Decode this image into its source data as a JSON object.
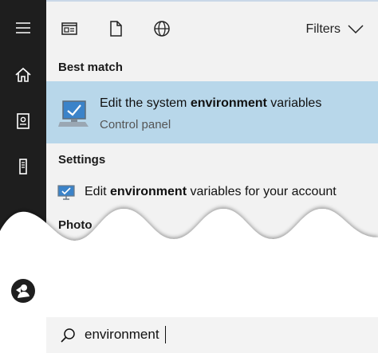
{
  "toolbar": {
    "apps_icon": "app-window-icon",
    "documents_icon": "document-icon",
    "web_icon": "globe-icon",
    "filters_label": "Filters"
  },
  "sidebar": {
    "items": [
      {
        "icon": "hamburger-menu-icon"
      },
      {
        "icon": "home-icon"
      },
      {
        "icon": "notebook-icon"
      },
      {
        "icon": "tower-icon"
      }
    ],
    "bottom_icon": "user-icon"
  },
  "results": {
    "best_match_header": "Best match",
    "best_match": {
      "title_pre": "Edit the system ",
      "title_bold": "environment",
      "title_post": " variables",
      "subtitle": "Control panel"
    },
    "settings_header": "Settings",
    "settings_item": {
      "pre": "Edit ",
      "bold": "environment",
      "post": " variables for your account"
    },
    "photos_header": "Photo"
  },
  "search": {
    "value": "environment"
  },
  "colors": {
    "rail": "#1e1e1e",
    "panel": "#f2f2f2",
    "highlight": "#b8d7ea"
  }
}
